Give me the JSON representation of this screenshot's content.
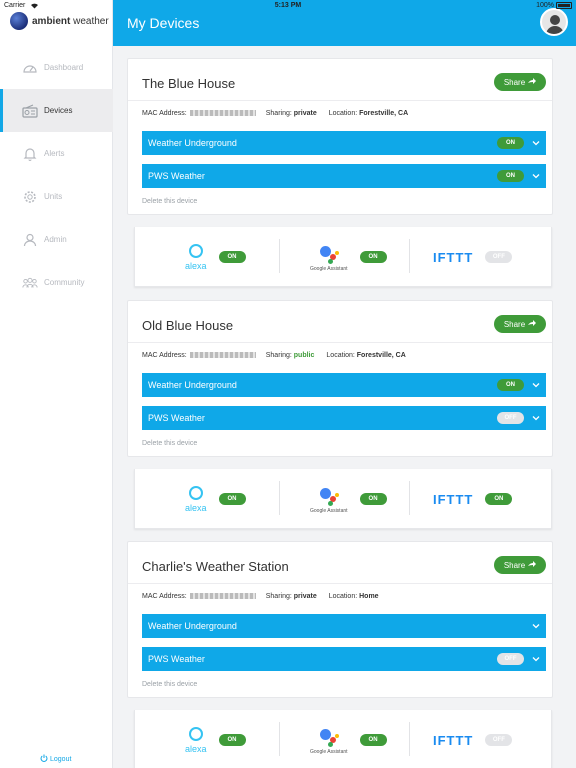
{
  "status_bar": {
    "carrier": "Carrier",
    "time": "5:13 PM",
    "battery": "100%"
  },
  "logo": {
    "bold": "ambient",
    "rest": " weather"
  },
  "sidebar": {
    "items": [
      {
        "label": "Dashboard",
        "icon": "gauge-icon"
      },
      {
        "label": "Devices",
        "icon": "radio-icon"
      },
      {
        "label": "Alerts",
        "icon": "bell-icon"
      },
      {
        "label": "Units",
        "icon": "gear-icon"
      },
      {
        "label": "Admin",
        "icon": "user-icon"
      },
      {
        "label": "Community",
        "icon": "users-icon"
      }
    ],
    "active": "Devices",
    "logout": "Logout"
  },
  "header": {
    "title": "My Devices"
  },
  "labels": {
    "share": "Share",
    "mac": "MAC Address:",
    "sharing": "Sharing:",
    "location": "Location:",
    "delete": "Delete this device",
    "alexa": "alexa",
    "google": "Google Assistant",
    "ifttt": "IFTTT"
  },
  "colors": {
    "accent": "#0fa8e8",
    "on": "#3f9b39",
    "off": "#e3e4e7"
  },
  "devices": [
    {
      "name": "The Blue House",
      "sharing": "private",
      "location": "Forestville, CA",
      "services": [
        {
          "label": "Weather Underground",
          "toggle": "ON"
        },
        {
          "label": "PWS Weather",
          "toggle": "ON"
        }
      ],
      "integrations": {
        "alexa": "ON",
        "google": "ON",
        "ifttt": "OFF"
      }
    },
    {
      "name": "Old Blue House",
      "sharing": "public",
      "location": "Forestville, CA",
      "services": [
        {
          "label": "Weather Underground",
          "toggle": "ON"
        },
        {
          "label": "PWS Weather",
          "toggle": "OFF"
        }
      ],
      "integrations": {
        "alexa": "ON",
        "google": "ON",
        "ifttt": "ON"
      }
    },
    {
      "name": "Charlie's Weather Station",
      "sharing": "private",
      "location": "Home",
      "services": [
        {
          "label": "Weather Underground",
          "toggle": ""
        },
        {
          "label": "PWS Weather",
          "toggle": "OFF"
        }
      ],
      "integrations": {
        "alexa": "ON",
        "google": "ON",
        "ifttt": "OFF"
      }
    }
  ]
}
